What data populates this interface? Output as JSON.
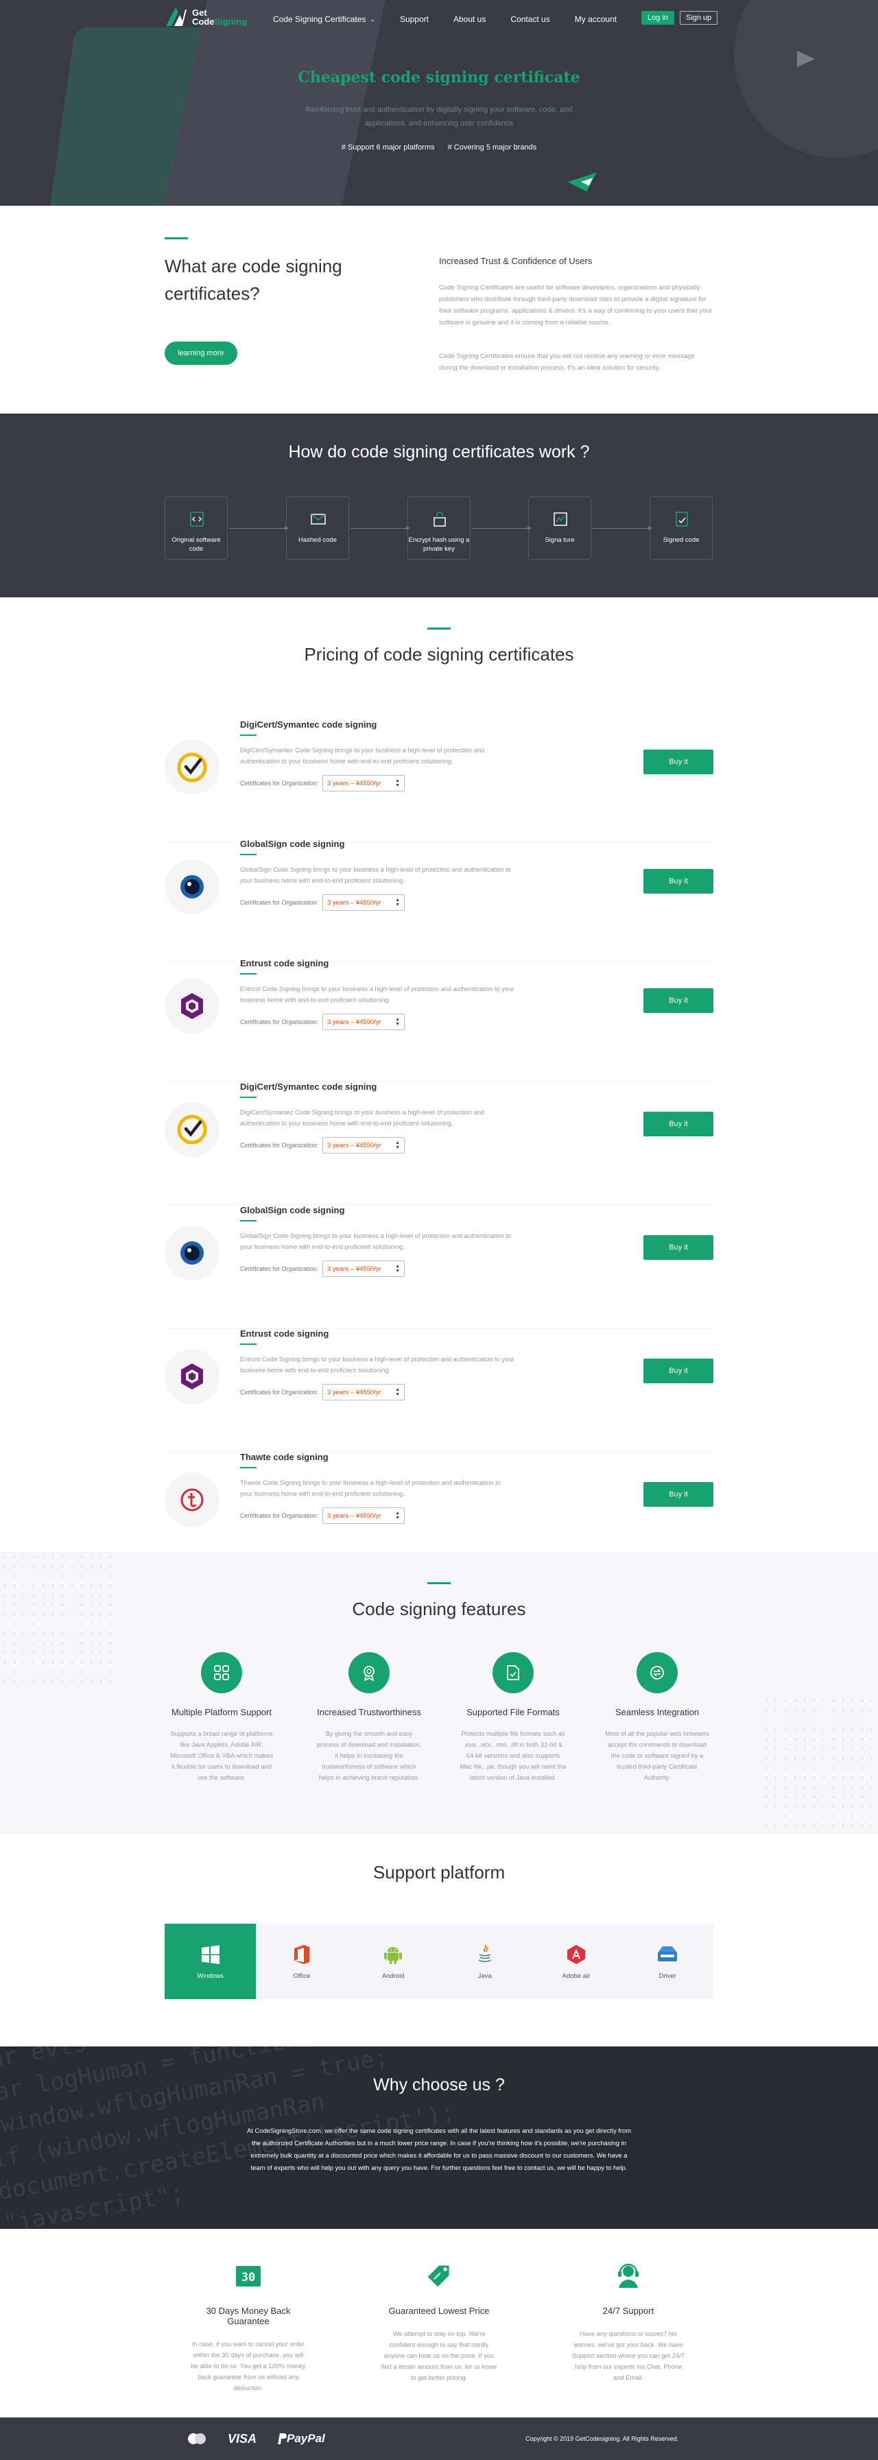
{
  "nav": {
    "logo_line1": "Get",
    "logo_line2a": "Code",
    "logo_line2b": "Signing",
    "menu": [
      {
        "label": "Code Signing Certificates"
      },
      {
        "label": "Support"
      },
      {
        "label": "About us"
      },
      {
        "label": "Contact us"
      },
      {
        "label": "My account"
      }
    ],
    "login": "Log in",
    "signup": "Sign up"
  },
  "hero": {
    "title": "Cheapest code signing certificate",
    "subtitle": "Reinforcing trust and authentication by digitally signing your software, code, and applications, and enhancing user confidence",
    "tag1": "# Support 6 major platforms",
    "tag2": "# Covering 5 major brands"
  },
  "what": {
    "title": "What are code signing certificates?",
    "learn_more": "learning more",
    "right_title": "Increased Trust & Confidence of Users",
    "p1": "Code Signing Certificates are useful for software developers, organizations and physically publishers who distribute through third-party download sites to provide a digital signature for their software programs, applications & drivers. It's a way of confirming to your users that your software is genuine and it is coming from a reliable source.",
    "p2": "Code Signing Certificates ensure that you will not receive any warning or error message during the download or installation process. It's an ideal solution for security."
  },
  "how": {
    "title": "How do code signing certificates work ?",
    "steps": [
      {
        "label": "Original software code"
      },
      {
        "label": "Hashed code"
      },
      {
        "label": "Encrypt hash using a private key"
      },
      {
        "label": "Signa ture"
      },
      {
        "label": "Signed code"
      }
    ]
  },
  "pricing": {
    "title": "Pricing of code signing certificates",
    "org_label": "Certificates for Organization:",
    "buy_label": "Buy it",
    "products": [
      {
        "name": "DigiCert/Symantec code signing",
        "desc": "DigiCert/Symantec Code Signing brings to your business a high-level of protection and authentication to your business home with end-to-end proficient solutioning.",
        "price": "3 years – ¥4550/yr",
        "icon": "digicert-check-icon"
      },
      {
        "name": "GlobalSign code signing",
        "desc": "GlobalSign Code Signing brings to your business a high-level of protection and authentication to your business home with end-to-end proficient solutioning.",
        "price": "3 years – ¥4550/yr",
        "icon": "globalsign-eye-icon"
      },
      {
        "name": "Entrust code signing",
        "desc": "Entrust Code Signing brings to your business a high-level of protection and authentication to your business home with end-to-end proficient solutioning.",
        "price": "3 years – ¥4550/yr",
        "icon": "entrust-hexagon-icon"
      },
      {
        "name": "DigiCert/Symantec code signing",
        "desc": "DigiCert/Symantec Code Signing brings to your business a high-level of protection and authentication to your business home with end-to-end proficient solutioning.",
        "price": "3 years – ¥4550/yr",
        "icon": "digicert-check-icon"
      },
      {
        "name": "GlobalSign code signing",
        "desc": "GlobalSign Code Signing brings to your business a high-level of protection and authentication to your business home with end-to-end proficient solutioning.",
        "price": "3 years – ¥4550/yr",
        "icon": "globalsign-eye-icon"
      },
      {
        "name": "Entrust code signing",
        "desc": "Entrust Code Signing brings to your business a high-level of protection and authentication to your business home with end-to-end proficient solutioning.",
        "price": "3 years – ¥4550/yr",
        "icon": "entrust-hexagon-icon"
      },
      {
        "name": "Thawte code signing",
        "desc": "Thawte Code Signing brings to your business a high-level of protection and authentication to your business home with end-to-end proficient solutioning.",
        "price": "3 years – ¥4550/yr",
        "icon": "thawte-icon"
      }
    ]
  },
  "features": {
    "title": "Code signing features",
    "items": [
      {
        "title": "Multiple Platform Support",
        "desc": "Supports a broad range of platforms like Java Applets, Adobe AIR, Microsoft Office & VBA which makes it flexible for users to download and use the software.",
        "icon": "grid-icon"
      },
      {
        "title": "Increased Trustworthiness",
        "desc": "By giving the smooth and easy process of download and installation, it helps in increasing the trustworthiness of software which helps in achieving brand reputation.",
        "icon": "badge-icon"
      },
      {
        "title": "Supported File Formats",
        "desc": "Protects multiple file formats such as .exe, .ocx, .msi, .dll in both 32-bit & 64-bit versions and also supports Mac file, .jar, though you will need the latest version of Java installed.",
        "icon": "file-icon"
      },
      {
        "title": "Seamless Integration",
        "desc": "Most of all the popular web browsers accept the commands to download the code or software signed by a trusted third-party Certificate Authority.",
        "icon": "integration-icon"
      }
    ]
  },
  "support": {
    "title": "Support platform",
    "platforms": [
      {
        "label": "Windows",
        "icon": "windows-icon"
      },
      {
        "label": "Office",
        "icon": "office-icon"
      },
      {
        "label": "Android",
        "icon": "android-icon"
      },
      {
        "label": "Java",
        "icon": "java-icon"
      },
      {
        "label": "Adobe air",
        "icon": "adobe-air-icon"
      },
      {
        "label": "Driver",
        "icon": "driver-icon"
      }
    ]
  },
  "why": {
    "title": "Why choose us ?",
    "text": "At CodeSigningStore.com, we offer the same code signing certificates with all the latest features and standards as you get directly from the authorized Certificate Authorities but in a much lower price range. In case if you're thinking how it's possible, we're purchasing in extremely bulk quantity at a discounted price which makes it affordable for us to pass massive discount to our customers. We have a team of experts who will help you out with any query you have. For further questions feel free to contact us, we will be happy to help.",
    "bg_code": "var evts = 'contextmenu dblclick drag drop';\nvar logHuman = function() { return; }\n(window.wflogHumanRan = true;\nif (window.wflogHumanRan\ndocument.createElement('script');\n\"javascript\";"
  },
  "guarantee": {
    "items": [
      {
        "title": "30 Days Money Back Guarantee",
        "desc": "In case, if you want to cancel your order within the 30 days of purchase, you will be able to do so. You get a 100% money back guarantee from us without any deduction.",
        "icon": "thirty-days-icon"
      },
      {
        "title": "Guaranteed Lowest Price",
        "desc": "We attempt to stay on top. We're confident enough to say that hardly anyone can beat us on the price. If you find a lesser amount than us, let us know to get better pricing.",
        "icon": "price-tag-icon"
      },
      {
        "title": "24/7 Support",
        "desc": "Have any questions or issues? No worries, we've got your back. We have Support section where you can get 24/7 help from our experts via Chat, Phone and Email.",
        "icon": "support-agent-icon"
      }
    ],
    "thirty_text": "30"
  },
  "footer": {
    "visa": "VISA",
    "paypal": "PayPal",
    "copyright": "Copyright © 2019 GetCodesigning. All Rights Reserved."
  },
  "colors": {
    "accent": "#17a26f",
    "dark": "#3a3a47",
    "price": "#e34d00"
  }
}
